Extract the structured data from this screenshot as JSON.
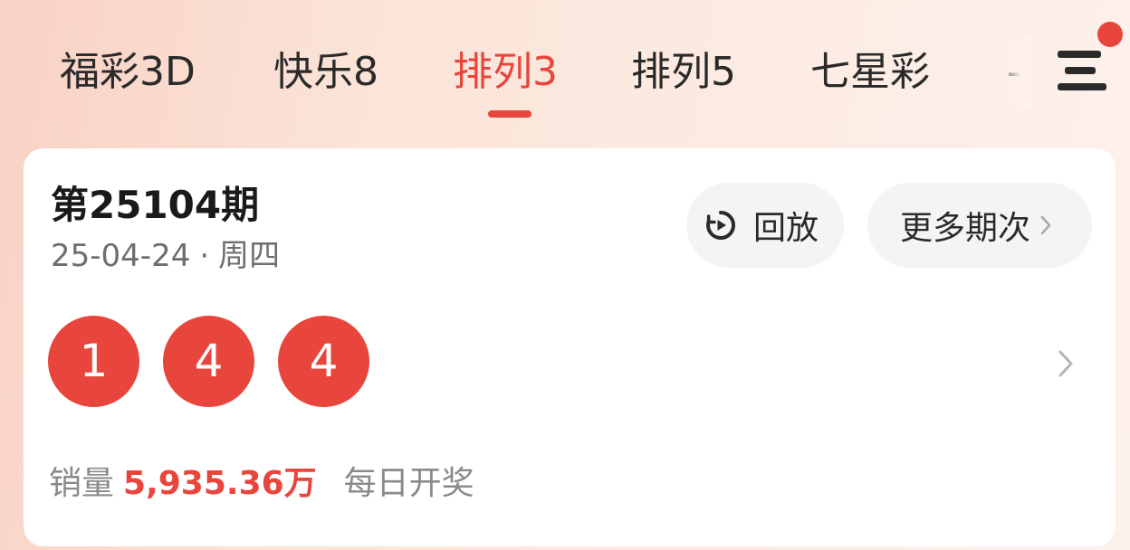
{
  "tabs": [
    {
      "label": "福彩3D",
      "active": false
    },
    {
      "label": "快乐8",
      "active": false
    },
    {
      "label": "排列3",
      "active": true
    },
    {
      "label": "排列5",
      "active": false
    },
    {
      "label": "七星彩",
      "active": false
    }
  ],
  "tab_partial": "-",
  "draw": {
    "issue": "第25104期",
    "date": "25-04-24",
    "separator": "·",
    "weekday": "周四",
    "numbers": [
      "1",
      "4",
      "4"
    ]
  },
  "actions": {
    "replay_label": "回放",
    "more_label": "更多期次"
  },
  "sales": {
    "label": "销量",
    "amount": "5,935.36万",
    "schedule": "每日开奖"
  },
  "colors": {
    "accent": "#e8453c",
    "text_primary": "#1a1a1a",
    "text_secondary": "#6e6e6e"
  },
  "icons": {
    "menu": "menu-icon",
    "replay": "replay-icon",
    "chevron": "chevron-right-icon",
    "notification_dot": "notification-dot"
  }
}
